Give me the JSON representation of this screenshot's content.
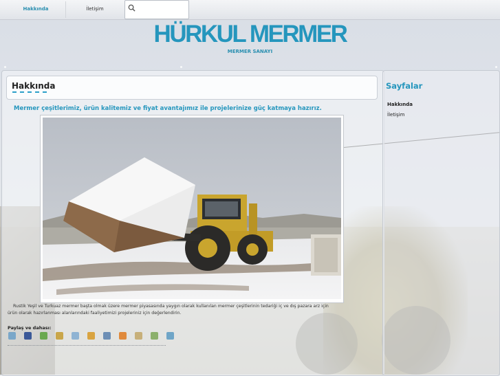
{
  "nav": {
    "items": [
      {
        "label": "Hakkında",
        "active": true
      },
      {
        "label": "İletişim",
        "active": false
      }
    ],
    "search_icon": "search-icon"
  },
  "header": {
    "title": "HÜRKUL MERMER",
    "subtitle": "MERMER SANAYI"
  },
  "main": {
    "page_title": "Hakkında",
    "tagline": "Mermer çeşitlerimiz, ürün kalitemiz ve fiyat avantajımız ile projelerinize güç katmaya hazırız.",
    "body_line1": "Rustik Yeşil ve Turkuaz mermer başta olmak üzere mermer piyasasında yaygın olarak kullanılan mermer çeşitlerinin tedariği iç ve dış pazara arz için",
    "body_line2": "ürün olarak hazırlanması alanlarındaki faaliyetimizi projeleriniz için değerlendirin.",
    "share_label": "Paylaş ve dahası:",
    "share_icons": [
      "email-icon",
      "facebook-icon",
      "google-icon",
      "favorites-icon",
      "twitter-icon",
      "digg-icon",
      "delicious-icon",
      "blogger-icon",
      "rss-icon",
      "print-icon",
      "stumble-icon"
    ],
    "share_colors": [
      "#7aa7c9",
      "#3b5998",
      "#6aa84f",
      "#c9a64a",
      "#8fb3d3",
      "#d9a441",
      "#6d8fb5",
      "#e08a3c",
      "#c7b07a",
      "#8cb06c",
      "#6fa5c7"
    ]
  },
  "sidebar": {
    "title": "Sayfalar",
    "links": [
      {
        "label": "Hakkında",
        "active": true
      },
      {
        "label": "İletişim",
        "active": false
      }
    ]
  },
  "colors": {
    "accent": "#2596bd",
    "text": "#222222"
  }
}
